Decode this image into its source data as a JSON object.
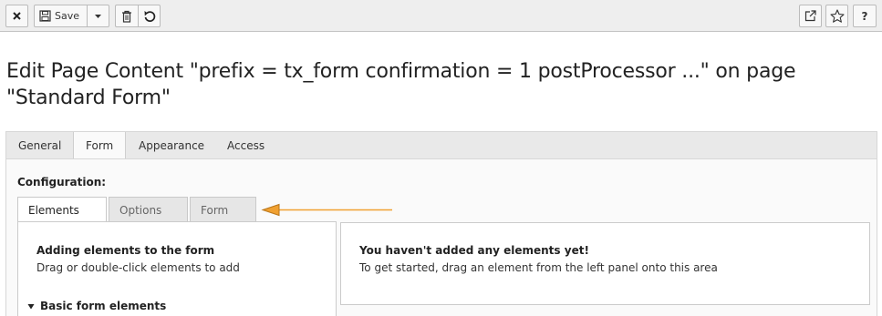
{
  "toolbar": {
    "close_icon": "close-icon",
    "save_label": "Save",
    "save_icon": "floppy-disk-icon",
    "split_icon": "caret-down-icon",
    "delete_icon": "trash-icon",
    "undo_icon": "undo-icon",
    "open_new_window_icon": "open-new-window-icon",
    "bookmark_icon": "star-icon",
    "help_label": "?"
  },
  "page": {
    "title": "Edit Page Content \"prefix = tx_form confirmation = 1 postProcessor ...\" on page \"Standard Form\""
  },
  "tabs": [
    {
      "label": "General"
    },
    {
      "label": "Form"
    },
    {
      "label": "Appearance"
    },
    {
      "label": "Access"
    }
  ],
  "form_tab": {
    "configuration_label": "Configuration:",
    "subtabs": [
      {
        "label": "Elements"
      },
      {
        "label": "Options"
      },
      {
        "label": "Form"
      }
    ],
    "left_pane": {
      "heading": "Adding elements to the form",
      "text": "Drag or double-click elements to add",
      "section_label": "Basic form elements"
    },
    "right_pane": {
      "heading": "You haven't added any elements yet!",
      "text": "To get started, drag an element from the left panel onto this area"
    }
  },
  "colors": {
    "annotation_arrow": "#f0a030",
    "toolbar_bg": "#eeeeee"
  }
}
